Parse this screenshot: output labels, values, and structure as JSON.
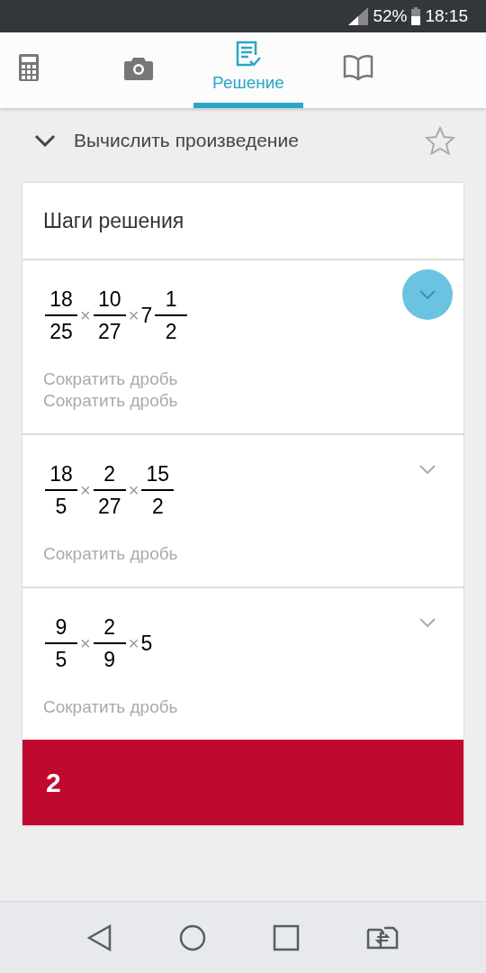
{
  "status_bar": {
    "battery": "52%",
    "time": "18:15"
  },
  "tabs": [
    {
      "kind": "calculator",
      "selected": false
    },
    {
      "kind": "camera",
      "selected": false
    },
    {
      "kind": "solution",
      "label": "Решение",
      "selected": true
    },
    {
      "kind": "book",
      "selected": false
    }
  ],
  "problem": {
    "title": "Вычислить произведение",
    "expanded": true,
    "favorite": false
  },
  "steps_card": {
    "title": "Шаги решения",
    "steps": [
      {
        "expanded": true,
        "terms": [
          {
            "kind": "fraction",
            "num": "18",
            "den": "25"
          },
          {
            "kind": "op",
            "text": "×"
          },
          {
            "kind": "fraction",
            "num": "10",
            "den": "27"
          },
          {
            "kind": "op",
            "text": "×"
          },
          {
            "kind": "number",
            "text": "7"
          },
          {
            "kind": "fraction",
            "num": "1",
            "den": "2"
          }
        ],
        "hints": [
          "Сократить дробь",
          "Сократить дробь"
        ]
      },
      {
        "expanded": false,
        "terms": [
          {
            "kind": "fraction",
            "num": "18",
            "den": "5"
          },
          {
            "kind": "op",
            "text": "×"
          },
          {
            "kind": "fraction",
            "num": "2",
            "den": "27"
          },
          {
            "kind": "op",
            "text": "×"
          },
          {
            "kind": "fraction",
            "num": "15",
            "den": "2"
          }
        ],
        "hints": [
          "Сократить дробь"
        ]
      },
      {
        "expanded": false,
        "terms": [
          {
            "kind": "fraction",
            "num": "9",
            "den": "5"
          },
          {
            "kind": "op",
            "text": "×"
          },
          {
            "kind": "fraction",
            "num": "2",
            "den": "9"
          },
          {
            "kind": "op",
            "text": "×"
          },
          {
            "kind": "number",
            "text": "5"
          }
        ],
        "hints": [
          "Сократить дробь"
        ]
      }
    ],
    "answer": "2"
  }
}
